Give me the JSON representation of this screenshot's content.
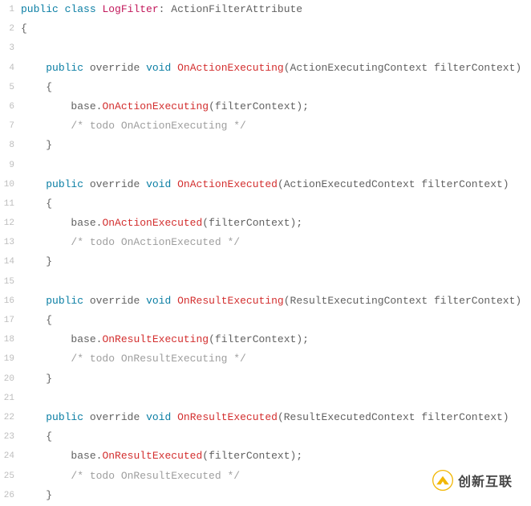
{
  "colors": {
    "keyword": "#0a7ea4",
    "className": "#c2185b",
    "method": "#d32f2f",
    "plain": "#616161",
    "comment": "#9e9e9e",
    "gutter": "#bdbdbd"
  },
  "watermark": {
    "text": "创新互联",
    "iconLetter": "X"
  },
  "lines": [
    {
      "n": 1,
      "indent": 0,
      "tokens": [
        {
          "c": "tok-kw",
          "t": "public"
        },
        {
          "c": "sp",
          "t": " "
        },
        {
          "c": "tok-kw",
          "t": "class"
        },
        {
          "c": "sp",
          "t": " "
        },
        {
          "c": "tok-class",
          "t": "LogFilter"
        },
        {
          "c": "tok-punc",
          "t": ": "
        },
        {
          "c": "tok-plain",
          "t": "ActionFilterAttribute"
        }
      ]
    },
    {
      "n": 2,
      "indent": 0,
      "tokens": [
        {
          "c": "tok-brace",
          "t": "{"
        }
      ]
    },
    {
      "n": 3,
      "indent": 0,
      "tokens": []
    },
    {
      "n": 4,
      "indent": 4,
      "tokens": [
        {
          "c": "tok-kw",
          "t": "public"
        },
        {
          "c": "sp",
          "t": " "
        },
        {
          "c": "tok-plain",
          "t": "override"
        },
        {
          "c": "sp",
          "t": " "
        },
        {
          "c": "tok-kw",
          "t": "void"
        },
        {
          "c": "sp",
          "t": " "
        },
        {
          "c": "tok-fn",
          "t": "OnActionExecuting"
        },
        {
          "c": "tok-punc",
          "t": "("
        },
        {
          "c": "tok-plain",
          "t": "ActionExecutingContext filterContext"
        },
        {
          "c": "tok-punc",
          "t": ")"
        }
      ]
    },
    {
      "n": 5,
      "indent": 4,
      "tokens": [
        {
          "c": "tok-brace",
          "t": "{"
        }
      ]
    },
    {
      "n": 6,
      "indent": 8,
      "tokens": [
        {
          "c": "tok-plain",
          "t": "base"
        },
        {
          "c": "tok-dot",
          "t": "."
        },
        {
          "c": "tok-fn",
          "t": "OnActionExecuting"
        },
        {
          "c": "tok-punc",
          "t": "("
        },
        {
          "c": "tok-plain",
          "t": "filterContext"
        },
        {
          "c": "tok-punc",
          "t": ");"
        }
      ]
    },
    {
      "n": 7,
      "indent": 8,
      "tokens": [
        {
          "c": "tok-cmt",
          "t": "/* todo OnActionExecuting */"
        }
      ]
    },
    {
      "n": 8,
      "indent": 4,
      "tokens": [
        {
          "c": "tok-brace",
          "t": "}"
        }
      ]
    },
    {
      "n": 9,
      "indent": 0,
      "tokens": []
    },
    {
      "n": 10,
      "indent": 4,
      "tokens": [
        {
          "c": "tok-kw",
          "t": "public"
        },
        {
          "c": "sp",
          "t": " "
        },
        {
          "c": "tok-plain",
          "t": "override"
        },
        {
          "c": "sp",
          "t": " "
        },
        {
          "c": "tok-kw",
          "t": "void"
        },
        {
          "c": "sp",
          "t": " "
        },
        {
          "c": "tok-fn",
          "t": "OnActionExecuted"
        },
        {
          "c": "tok-punc",
          "t": "("
        },
        {
          "c": "tok-plain",
          "t": "ActionExecutedContext filterContext"
        },
        {
          "c": "tok-punc",
          "t": ")"
        }
      ]
    },
    {
      "n": 11,
      "indent": 4,
      "tokens": [
        {
          "c": "tok-brace",
          "t": "{"
        }
      ]
    },
    {
      "n": 12,
      "indent": 8,
      "tokens": [
        {
          "c": "tok-plain",
          "t": "base"
        },
        {
          "c": "tok-dot",
          "t": "."
        },
        {
          "c": "tok-fn",
          "t": "OnActionExecuted"
        },
        {
          "c": "tok-punc",
          "t": "("
        },
        {
          "c": "tok-plain",
          "t": "filterContext"
        },
        {
          "c": "tok-punc",
          "t": ");"
        }
      ]
    },
    {
      "n": 13,
      "indent": 8,
      "tokens": [
        {
          "c": "tok-cmt",
          "t": "/* todo OnActionExecuted */"
        }
      ]
    },
    {
      "n": 14,
      "indent": 4,
      "tokens": [
        {
          "c": "tok-brace",
          "t": "}"
        }
      ]
    },
    {
      "n": 15,
      "indent": 0,
      "tokens": []
    },
    {
      "n": 16,
      "indent": 4,
      "tokens": [
        {
          "c": "tok-kw",
          "t": "public"
        },
        {
          "c": "sp",
          "t": " "
        },
        {
          "c": "tok-plain",
          "t": "override"
        },
        {
          "c": "sp",
          "t": " "
        },
        {
          "c": "tok-kw",
          "t": "void"
        },
        {
          "c": "sp",
          "t": " "
        },
        {
          "c": "tok-fn",
          "t": "OnResultExecuting"
        },
        {
          "c": "tok-punc",
          "t": "("
        },
        {
          "c": "tok-plain",
          "t": "ResultExecutingContext filterContext"
        },
        {
          "c": "tok-punc",
          "t": ")"
        }
      ]
    },
    {
      "n": 17,
      "indent": 4,
      "tokens": [
        {
          "c": "tok-brace",
          "t": "{"
        }
      ]
    },
    {
      "n": 18,
      "indent": 8,
      "tokens": [
        {
          "c": "tok-plain",
          "t": "base"
        },
        {
          "c": "tok-dot",
          "t": "."
        },
        {
          "c": "tok-fn",
          "t": "OnResultExecuting"
        },
        {
          "c": "tok-punc",
          "t": "("
        },
        {
          "c": "tok-plain",
          "t": "filterContext"
        },
        {
          "c": "tok-punc",
          "t": ");"
        }
      ]
    },
    {
      "n": 19,
      "indent": 8,
      "tokens": [
        {
          "c": "tok-cmt",
          "t": "/* todo OnResultExecuting */"
        }
      ]
    },
    {
      "n": 20,
      "indent": 4,
      "tokens": [
        {
          "c": "tok-brace",
          "t": "}"
        }
      ]
    },
    {
      "n": 21,
      "indent": 0,
      "tokens": []
    },
    {
      "n": 22,
      "indent": 4,
      "tokens": [
        {
          "c": "tok-kw",
          "t": "public"
        },
        {
          "c": "sp",
          "t": " "
        },
        {
          "c": "tok-plain",
          "t": "override"
        },
        {
          "c": "sp",
          "t": " "
        },
        {
          "c": "tok-kw",
          "t": "void"
        },
        {
          "c": "sp",
          "t": " "
        },
        {
          "c": "tok-fn",
          "t": "OnResultExecuted"
        },
        {
          "c": "tok-punc",
          "t": "("
        },
        {
          "c": "tok-plain",
          "t": "ResultExecutedContext filterContext"
        },
        {
          "c": "tok-punc",
          "t": ")"
        }
      ]
    },
    {
      "n": 23,
      "indent": 4,
      "tokens": [
        {
          "c": "tok-brace",
          "t": "{"
        }
      ]
    },
    {
      "n": 24,
      "indent": 8,
      "tokens": [
        {
          "c": "tok-plain",
          "t": "base"
        },
        {
          "c": "tok-dot",
          "t": "."
        },
        {
          "c": "tok-fn",
          "t": "OnResultExecuted"
        },
        {
          "c": "tok-punc",
          "t": "("
        },
        {
          "c": "tok-plain",
          "t": "filterContext"
        },
        {
          "c": "tok-punc",
          "t": ");"
        }
      ]
    },
    {
      "n": 25,
      "indent": 8,
      "tokens": [
        {
          "c": "tok-cmt",
          "t": "/* todo OnResultExecuted */"
        }
      ]
    },
    {
      "n": 26,
      "indent": 4,
      "tokens": [
        {
          "c": "tok-brace",
          "t": "}"
        }
      ]
    }
  ]
}
